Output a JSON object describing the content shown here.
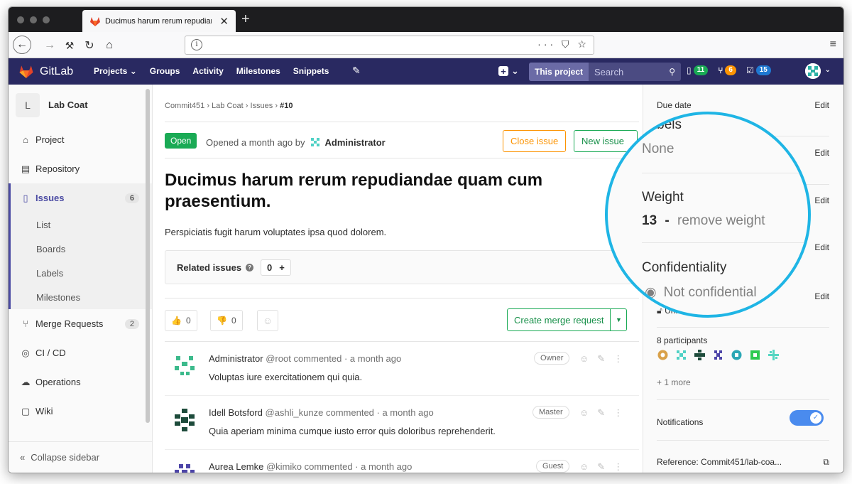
{
  "browser": {
    "tab_title": "Ducimus harum rerum repudian",
    "tab_close": "✕",
    "new_tab": "+",
    "url_info": "i",
    "url_actions": "··· ⛉ ☆",
    "menu": "≡"
  },
  "header": {
    "brand": "GitLab",
    "menu": [
      "Projects ⌄",
      "Groups",
      "Activity",
      "Milestones",
      "Snippets"
    ],
    "search_scope": "This project",
    "search_placeholder": "Search",
    "counters": [
      {
        "icon": "todo-icon",
        "value": "11",
        "color": "#1aaa55"
      },
      {
        "icon": "merge-request-icon",
        "value": "6",
        "color": "#fc9403"
      },
      {
        "icon": "issues-check-icon",
        "value": "15",
        "color": "#1f78d1"
      }
    ]
  },
  "sidebar": {
    "project_initial": "L",
    "project_name": "Lab Coat",
    "items": [
      {
        "label": "Project",
        "icon": "home-icon"
      },
      {
        "label": "Repository",
        "icon": "book-icon"
      },
      {
        "label": "Issues",
        "icon": "issues-icon",
        "count": "6"
      },
      {
        "label": "Merge Requests",
        "icon": "merge-request-icon",
        "count": "2"
      },
      {
        "label": "CI / CD",
        "icon": "rocket-icon"
      },
      {
        "label": "Operations",
        "icon": "cloud-icon"
      },
      {
        "label": "Wiki",
        "icon": "book-open-icon"
      }
    ],
    "subitems": [
      "List",
      "Boards",
      "Labels",
      "Milestones"
    ],
    "collapse": "Collapse sidebar"
  },
  "breadcrumb": {
    "group": "Commit451",
    "project": "Lab Coat",
    "section": "Issues",
    "current": "#10",
    "separator": "›"
  },
  "issue": {
    "status": "Open",
    "opened_prefix": "Opened a month ago by",
    "author": "Administrator",
    "close_label": "Close issue",
    "new_label": "New issue",
    "title": "Ducimus harum rerum repudiandae quam cum praesentium.",
    "description": "Perspiciatis fugit harum voluptates ipsa quod dolorem.",
    "related_label": "Related issues",
    "related_count": "0",
    "related_add": "+",
    "thumbs_up": "0",
    "thumbs_down": "0",
    "create_mr": "Create merge request"
  },
  "notes": [
    {
      "author": "Administrator",
      "handle": "@root",
      "meta": "commented · a month ago",
      "role": "Owner",
      "body": "Voluptas iure exercitationem qui quia."
    },
    {
      "author": "Idell Botsford",
      "handle": "@ashli_kunze",
      "meta": "commented · a month ago",
      "role": "Master",
      "body": "Quia aperiam minima cumque iusto error quis doloribus reprehenderit."
    },
    {
      "author": "Aurea Lemke",
      "handle": "@kimiko",
      "meta": "commented · a month ago",
      "role": "Guest",
      "body": ""
    }
  ],
  "right_sidebar": {
    "due_date_label": "Due date",
    "edit": "Edit",
    "lock_label": "Unlocked",
    "participants": "8 participants",
    "more": "+ 1 more",
    "notifications": "Notifications",
    "reference": "Reference: Commit451/lab-coa..."
  },
  "magnifier": {
    "labels": "Labels",
    "labels_value": "None",
    "weight_label": "Weight",
    "weight_value": "13",
    "weight_dash": "-",
    "remove_weight": "remove weight",
    "confidentiality": "Confidentiality",
    "not_confidential": "Not confidential"
  },
  "colors": {
    "header": "#292961",
    "accent": "#1fb5e5",
    "open": "#1aaa55",
    "close": "#fc9403"
  }
}
